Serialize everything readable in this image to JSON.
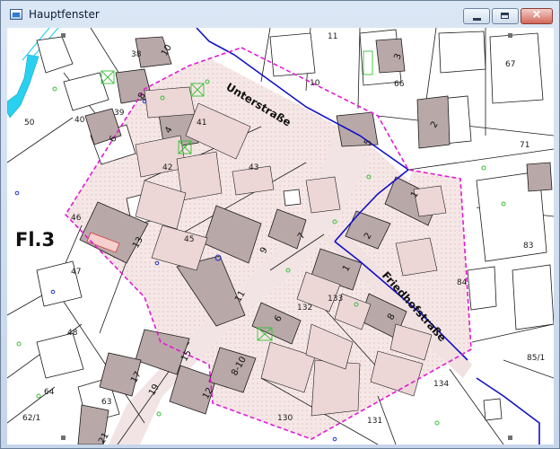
{
  "window": {
    "title": "Hauptfenster",
    "icon": "app-window-icon",
    "controls": {
      "minimize": "minimize-icon",
      "maximize": "maximize-icon",
      "close": "×"
    }
  },
  "colors": {
    "building_dark": "#b9a8a8",
    "building_light": "#ecd6d6",
    "highlight_fill": "#f6e7e7",
    "boundary_dashed": "#e21ad4",
    "parcel_line": "#1a1a1a",
    "street_line": "#1010c8",
    "water": "#2ad0f0",
    "point_green": "#35c235",
    "point_blue": "#2233cc"
  },
  "map": {
    "flur_label": "Fl.3",
    "streets": {
      "unterstrasse": "Unterstraße",
      "friedhofstrasse": "Friedhofstraße"
    },
    "parcels": {
      "p11": "11",
      "p67": "67",
      "p10": "10",
      "p66": "66",
      "p71": "71",
      "p38": "38",
      "p50": "50",
      "p40": "40",
      "p39": "39",
      "p41": "41",
      "p42": "42",
      "p43": "43",
      "p46": "46",
      "p45": "45",
      "p47": "47",
      "p48": "48",
      "p83": "83",
      "p84": "84",
      "p85_1": "85/1",
      "p133": "133",
      "p132": "132",
      "p134": "134",
      "p131": "131",
      "p130": "130",
      "p62_1": "62/1",
      "p64": "64",
      "p63": "63"
    },
    "house_numbers": {
      "h10": "10",
      "h3": "3",
      "h8a": "8",
      "h6": "6",
      "h4": "4",
      "h13": "13",
      "h9": "9",
      "h7": "7",
      "h5": "5",
      "h2a": "2",
      "h1a": "1",
      "h2b": "2",
      "h1b": "1",
      "h8b": "8",
      "h6b": "6",
      "h11": "11",
      "h15": "15",
      "h17": "17",
      "h19": "19",
      "h8_10": "8-10",
      "h12": "12",
      "h21": "21"
    }
  }
}
